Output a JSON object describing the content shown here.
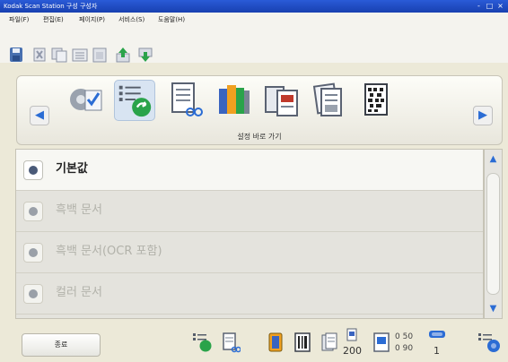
{
  "window": {
    "title": "Kodak Scan Station 구성 구성자",
    "controls": [
      "-",
      "□",
      "×"
    ]
  },
  "menubar": {
    "items": [
      "파일(F)",
      "편집(E)",
      "페이지(P)",
      "서비스(S)",
      "도움말(H)"
    ]
  },
  "toolbar": {
    "icons": [
      "save-icon",
      "delete-icon",
      "copy-icon",
      "list-icon",
      "paste-icon",
      "export-icon",
      "import-icon"
    ]
  },
  "ribbon": {
    "caption": "설정 바로 가기",
    "icons": [
      "settings-checklist-icon",
      "list-arrow-icon",
      "document-link-icon",
      "books-icon",
      "documents-icon",
      "scan-document-icon",
      "barcode-page-icon"
    ],
    "selected_index": 1,
    "nav_left": "◀",
    "nav_right": "▶"
  },
  "profiles": {
    "items": [
      {
        "label": "기본값",
        "state": "active"
      },
      {
        "label": "흑백 문서",
        "state": "dim"
      },
      {
        "label": "흑백 문서(OCR 포함)",
        "state": "dim"
      },
      {
        "label": "컬러 문서",
        "state": "dim"
      }
    ]
  },
  "statusbar": {
    "end_button": "종료",
    "icons": [
      "list-arrow-icon",
      "document-link-icon",
      "color-icon",
      "barcode-icon",
      "stack-icon",
      "resolution-icon",
      "document-page-icon",
      "network-icon",
      "keyboard-icon",
      "network-share-icon"
    ],
    "resolution": "200",
    "count_top": "0 50",
    "count_bottom": "0 90",
    "page_count": "1"
  },
  "colors": {
    "accent_blue": "#2b6cd4",
    "title_blue": "#1f4fc4",
    "green_arrow": "#2aa34a"
  }
}
